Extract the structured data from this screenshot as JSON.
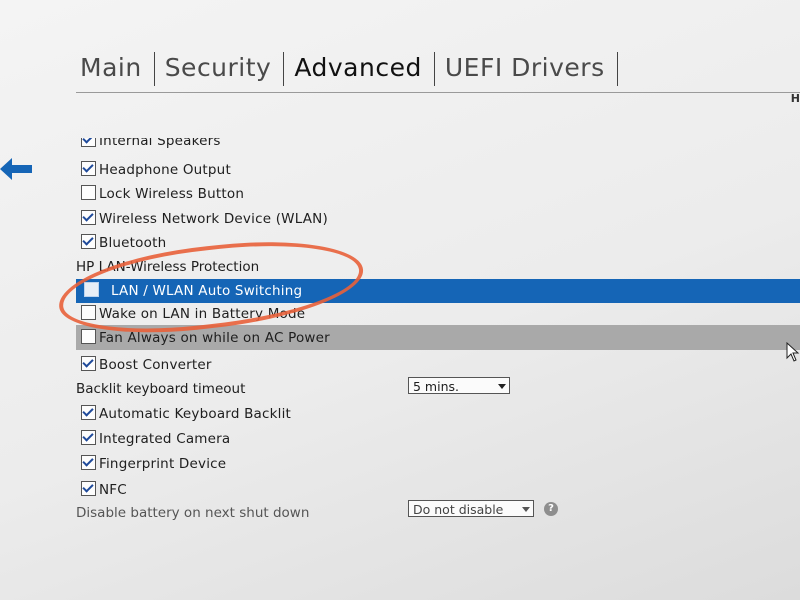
{
  "tabs": [
    {
      "label": "Main",
      "active": false
    },
    {
      "label": "Security",
      "active": false
    },
    {
      "label": "Advanced",
      "active": true
    },
    {
      "label": "UEFI Drivers",
      "active": false
    }
  ],
  "corner_text": "H",
  "items": [
    {
      "label": "Internal Speakers",
      "checked": true
    },
    {
      "label": "Headphone Output",
      "checked": true
    },
    {
      "label": "Lock Wireless Button",
      "checked": false
    },
    {
      "label": "Wireless Network Device (WLAN)",
      "checked": true
    },
    {
      "label": "Bluetooth",
      "checked": true
    }
  ],
  "section_heading": "HP LAN-Wireless Protection",
  "lan_items": [
    {
      "label": "LAN / WLAN Auto Switching",
      "checked": false,
      "selected": true
    },
    {
      "label": "Wake on LAN in Battery Mode",
      "checked": false
    }
  ],
  "fan": {
    "label": "Fan Always on while on AC Power",
    "checked": false
  },
  "boost": {
    "label": "Boost Converter",
    "checked": true
  },
  "backlit": {
    "label": "Backlit keyboard timeout",
    "value": "5 mins."
  },
  "items2": [
    {
      "label": "Automatic Keyboard Backlit",
      "checked": true
    },
    {
      "label": "Integrated Camera",
      "checked": true
    },
    {
      "label": "Fingerprint Device",
      "checked": true
    },
    {
      "label": "NFC",
      "checked": true
    }
  ],
  "battery": {
    "label": "Disable battery on next shut down",
    "value": "Do not disable"
  },
  "help_glyph": "?",
  "colors": {
    "selection": "#1565b6",
    "annotation": "#e8613a",
    "checkmark": "#1f4a9a"
  }
}
